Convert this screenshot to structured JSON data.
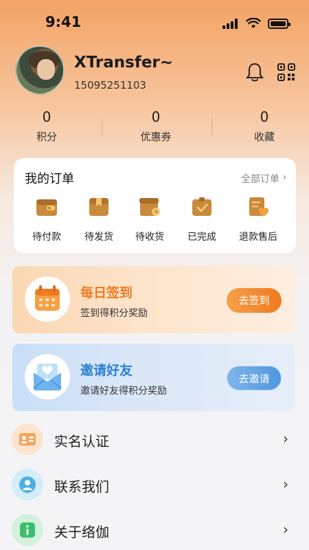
{
  "status_bar": {
    "time": "9:41"
  },
  "profile": {
    "name": "XTransfer~",
    "phone": "15095251103"
  },
  "stats": [
    {
      "value": "0",
      "label": "积分"
    },
    {
      "value": "0",
      "label": "优惠券"
    },
    {
      "value": "0",
      "label": "收藏"
    }
  ],
  "orders": {
    "title": "我的订单",
    "all_link": "全部订单",
    "items": [
      {
        "label": "待付款",
        "icon": "wallet-icon"
      },
      {
        "label": "待发货",
        "icon": "package-icon"
      },
      {
        "label": "待收货",
        "icon": "box-clock-icon"
      },
      {
        "label": "已完成",
        "icon": "box-check-icon"
      },
      {
        "label": "退款售后",
        "icon": "refund-doc-icon"
      }
    ]
  },
  "promos": {
    "sign_in": {
      "title": "每日签到",
      "subtitle": "签到得积分奖励",
      "button": "去签到",
      "accent": "#f07a21"
    },
    "invite": {
      "title": "邀请好友",
      "subtitle": "邀请好友得积分奖励",
      "button": "去邀请",
      "accent": "#2d7fd3"
    }
  },
  "menu": [
    {
      "label": "实名认证",
      "icon": "id-card-icon"
    },
    {
      "label": "联系我们",
      "icon": "contact-icon"
    },
    {
      "label": "关于络伽",
      "icon": "info-icon"
    }
  ],
  "colors": {
    "brand_orange": "#f07a21",
    "brand_blue": "#2d7fd3"
  }
}
